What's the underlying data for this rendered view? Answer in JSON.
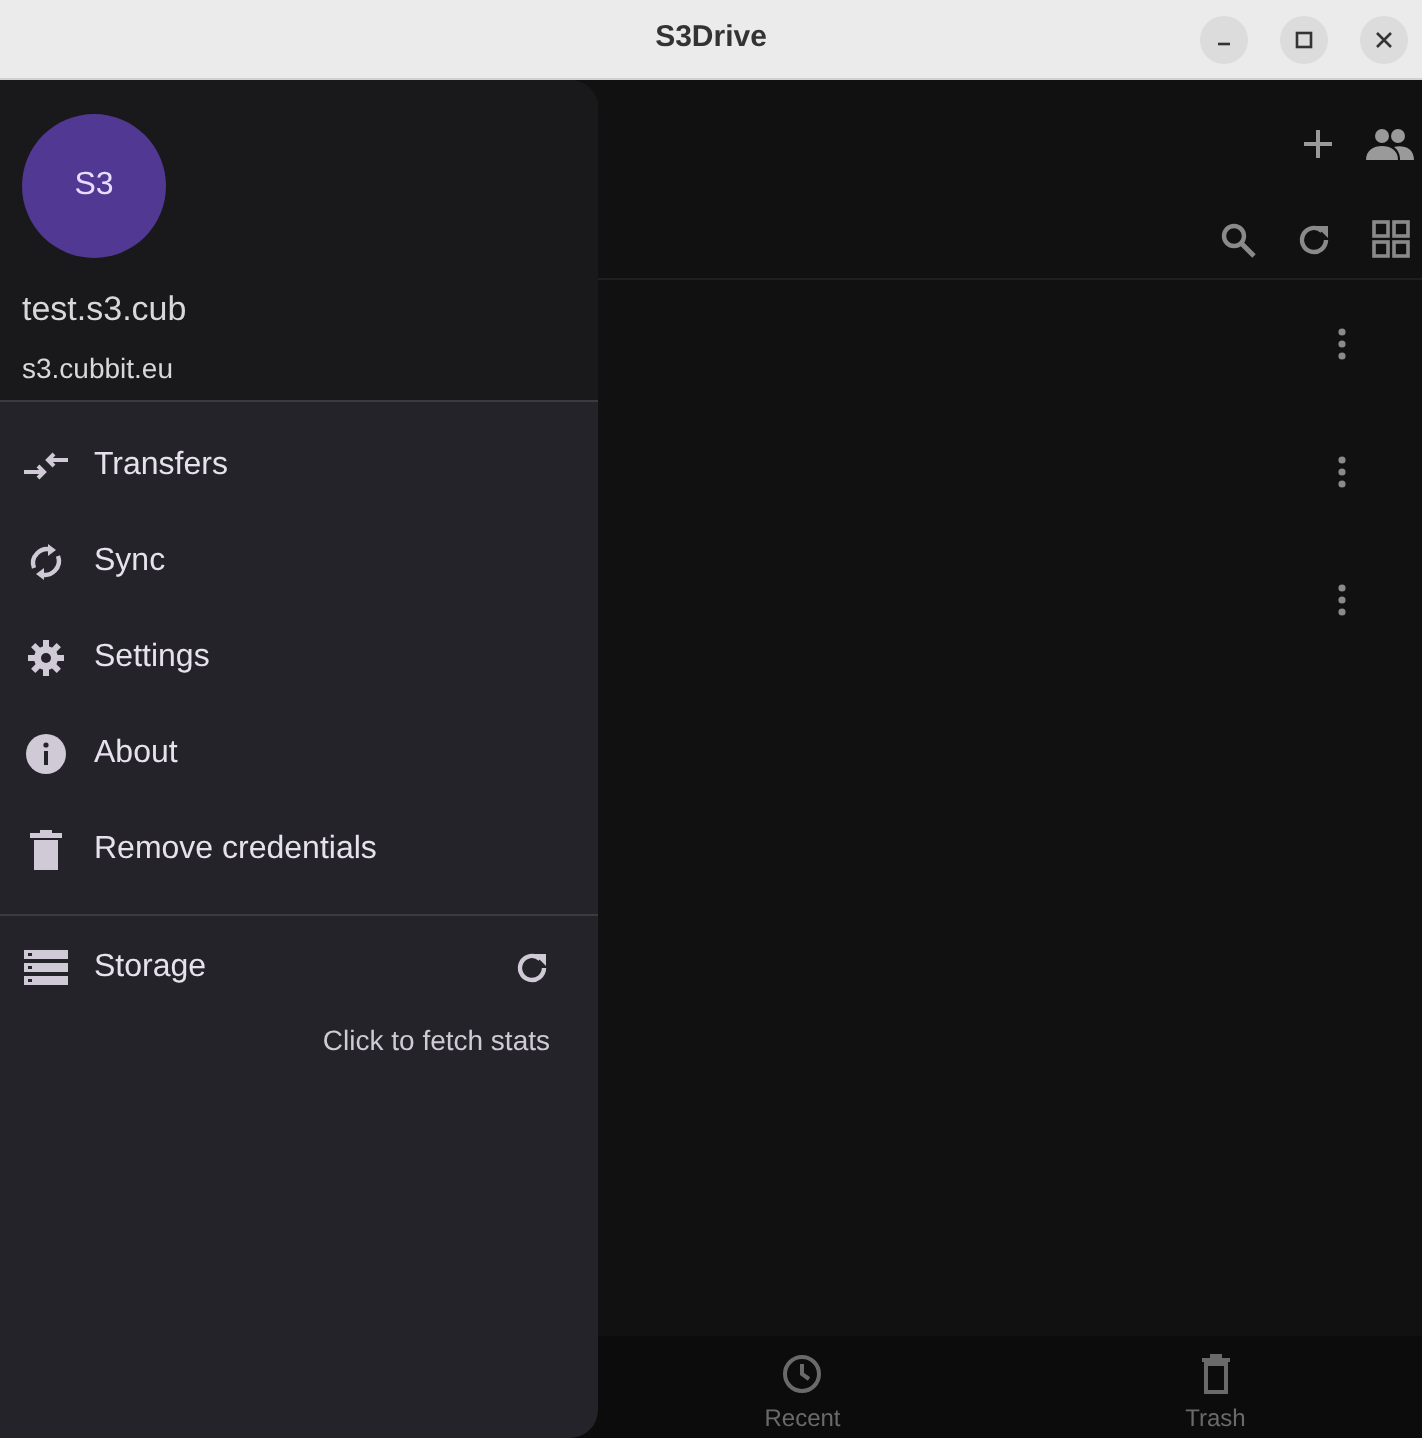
{
  "window": {
    "title": "S3Drive"
  },
  "drawer": {
    "avatar": "S3",
    "account": "test.s3.cub",
    "endpoint": "s3.cubbit.eu",
    "items": [
      {
        "kind": "transfers",
        "label": "Transfers"
      },
      {
        "kind": "sync",
        "label": "Sync"
      },
      {
        "kind": "settings",
        "label": "Settings"
      },
      {
        "kind": "about",
        "label": "About"
      },
      {
        "kind": "delete",
        "label": "Remove credentials"
      }
    ],
    "storage": {
      "label": "Storage",
      "hint": "Click to fetch stats"
    }
  },
  "file_rows": [
    {
      "kind": "row"
    },
    {
      "kind": "row"
    },
    {
      "kind": "row"
    }
  ],
  "bottom_nav": [
    {
      "kind": "recent",
      "label": "Recent"
    },
    {
      "kind": "trash",
      "label": "Trash"
    }
  ]
}
